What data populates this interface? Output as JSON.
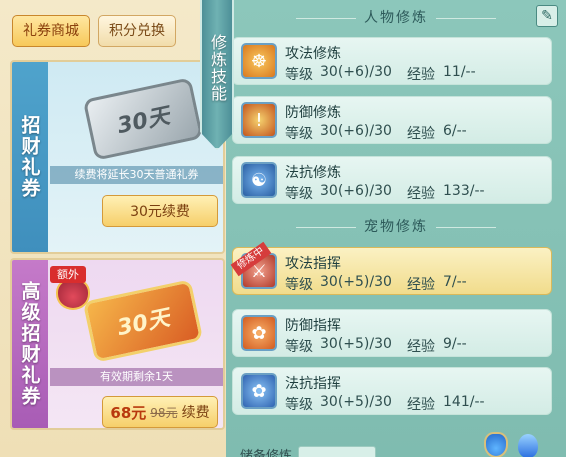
{
  "shop": {
    "tabs": [
      {
        "label": "礼券商城",
        "active": true
      },
      {
        "label": "积分兑换",
        "active": false
      }
    ],
    "cards": [
      {
        "side_label": "招财礼券",
        "ticket_label": "30天",
        "note": "续费将延长30天普通礼券",
        "button_label": "30元续费"
      },
      {
        "side_label": "高级招财礼券",
        "extra_badge": "额外",
        "ticket_label": "30天",
        "note": "有效期剩余1天",
        "button_price_new": "68元",
        "button_price_old": "98元",
        "button_suffix": "续费"
      }
    ]
  },
  "banner": {
    "label": "修炼技能"
  },
  "skills": {
    "person_header": "人物修炼",
    "pet_header": "宠物修炼",
    "level_label": "等级",
    "exp_label": "经验",
    "person": [
      {
        "name": "攻法修炼",
        "level": "30(+6)/30",
        "exp": "11/--",
        "icon": "meditation-icon"
      },
      {
        "name": "防御修炼",
        "level": "30(+6)/30",
        "exp": "6/--",
        "icon": "shield-icon"
      },
      {
        "name": "法抗修炼",
        "level": "30(+6)/30",
        "exp": "133/--",
        "icon": "yin-yang-icon"
      }
    ],
    "pet": [
      {
        "name": "攻法指挥",
        "level": "30(+5)/30",
        "exp": "7/--",
        "icon": "attack-icon",
        "tag": "修炼中",
        "active": true
      },
      {
        "name": "防御指挥",
        "level": "30(+5)/30",
        "exp": "9/--",
        "icon": "paw-shield-icon"
      },
      {
        "name": "法抗指挥",
        "level": "30(+5)/30",
        "exp": "141/--",
        "icon": "paw-magic-icon"
      }
    ],
    "reserve_label": "储备修炼"
  },
  "colors": {
    "panel_bg": "#8cc7bb",
    "row_bg": "#e7f6f2",
    "active_row_bg": "#fbf1c3",
    "price_red": "#b8390e"
  }
}
